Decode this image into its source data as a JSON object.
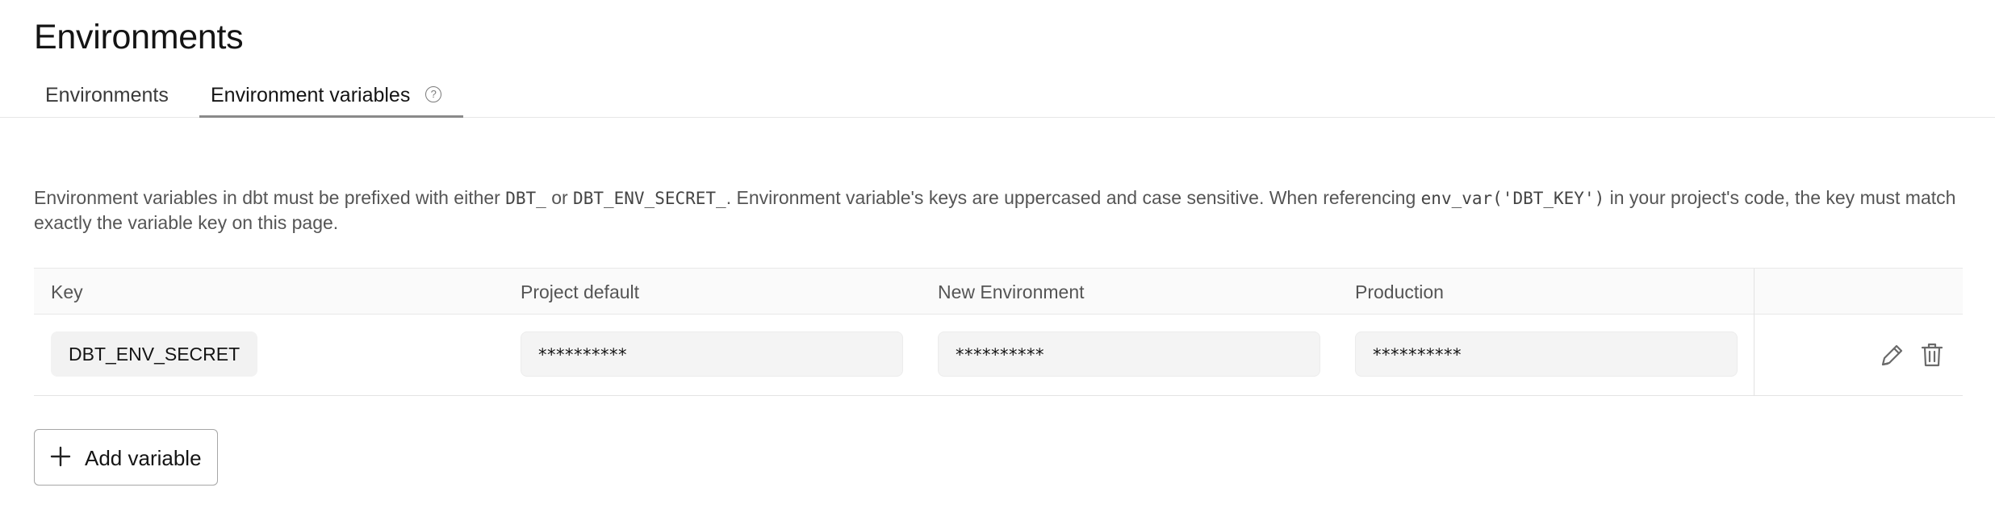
{
  "page": {
    "title": "Environments"
  },
  "tabs": [
    {
      "label": "Environments",
      "active": false
    },
    {
      "label": "Environment variables",
      "active": true
    }
  ],
  "description": {
    "part1": "Environment variables in dbt must be prefixed with either ",
    "code1": "DBT_",
    "part2": " or ",
    "code2": "DBT_ENV_SECRET_",
    "part3": ". Environment variable's keys are uppercased and case sensitive. When referencing ",
    "code3": "env_var('DBT_KEY')",
    "part4": " in your project's code, the key must match exactly the variable key on this page."
  },
  "table": {
    "columns": [
      "Key",
      "Project default",
      "New Environment",
      "Production"
    ],
    "rows": [
      {
        "key": "DBT_ENV_SECRET",
        "project_default": "**********",
        "new_environment": "**********",
        "production": "**********"
      }
    ]
  },
  "actions": {
    "add_variable_label": "Add variable"
  },
  "icons": {
    "help": "help-circle-icon",
    "edit": "pencil-icon",
    "delete": "trash-icon",
    "add": "plus-icon"
  },
  "colors": {
    "active_tab_underline": "#8a8a8a",
    "field_bg": "#f4f4f4",
    "text_muted": "#555555"
  }
}
